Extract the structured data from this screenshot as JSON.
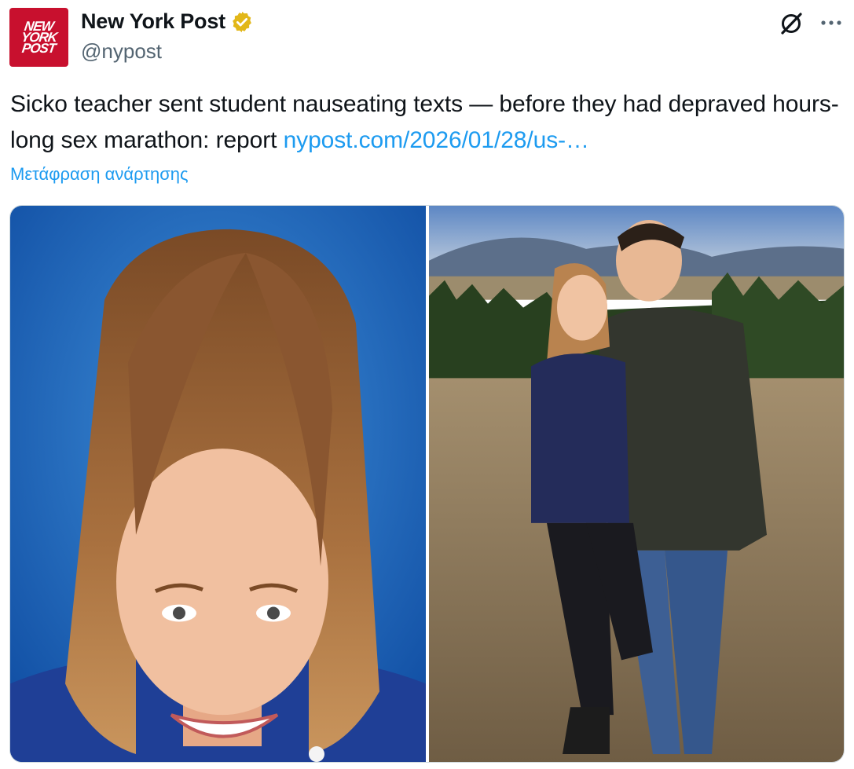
{
  "author": {
    "display_name": "New York Post",
    "handle": "@nypost",
    "avatar_logo_lines": [
      "NEW",
      "YORK",
      "POST"
    ],
    "verified_badge_color": "#e2b719",
    "avatar_color": "#c8102e"
  },
  "header": {
    "grok_icon": "grok-icon",
    "more_icon": "more-horizontal-icon"
  },
  "tweet": {
    "text": "Sicko teacher sent student nauseating texts — before they had depraved hours-long sex marathon: report ",
    "link_text": "nypost.com/2026/01/28/us-…",
    "translate_label": "Μετάφραση ανάρτησης",
    "link_color": "#1d9bf0"
  },
  "media": {
    "count": 2
  }
}
